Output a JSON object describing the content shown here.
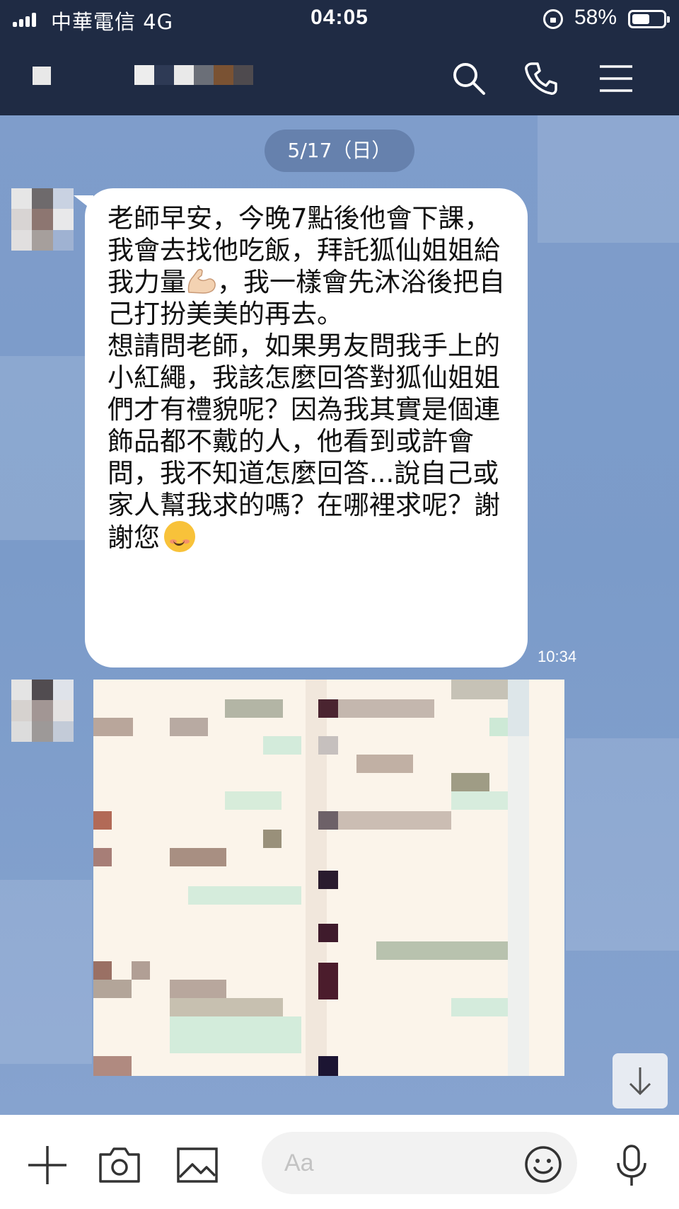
{
  "status_bar": {
    "carrier": "中華電信  4G",
    "time": "04:05",
    "battery_percent": "58%",
    "battery_level": 0.58,
    "signal_icon": "signal-bars-icon",
    "rotation_lock_icon": "rotation-lock-icon"
  },
  "header": {
    "search_icon": "search-icon",
    "call_icon": "phone-icon",
    "menu_icon": "menu-icon"
  },
  "chat": {
    "date_separator": "5/17（日）",
    "message": {
      "text_part1": "老師早安，今晚7點後他會下課，我會去找他吃飯，拜託狐仙姐姐給我力量",
      "text_part2": "，我一樣會先沐浴後把自己打扮美美的再去。\n想請問老師，如果男友問我手上的小紅繩，我該怎麼回答對狐仙姐姐們才有禮貌呢？因為我其實是個連飾品都不戴的人，他看到或許會問，我不知道怎麼回答...說自己或家人幫我求的嗎？在哪裡求呢？謝謝您",
      "time": "10:34",
      "emoji_1": "flexed-biceps-emoji",
      "emoji_2": "smiling-face-emoji"
    },
    "scroll_down_icon": "arrow-down-icon"
  },
  "input_bar": {
    "placeholder": "Aa",
    "add_icon": "plus-icon",
    "camera_icon": "camera-icon",
    "gallery_icon": "image-icon",
    "emoji_icon": "emoji-icon",
    "mic_icon": "microphone-icon"
  },
  "colors": {
    "header_bg": "#1f2b44",
    "chat_bg": "#7e9cc9",
    "bubble_bg": "#ffffff",
    "date_pill_bg": "#6681ad"
  }
}
